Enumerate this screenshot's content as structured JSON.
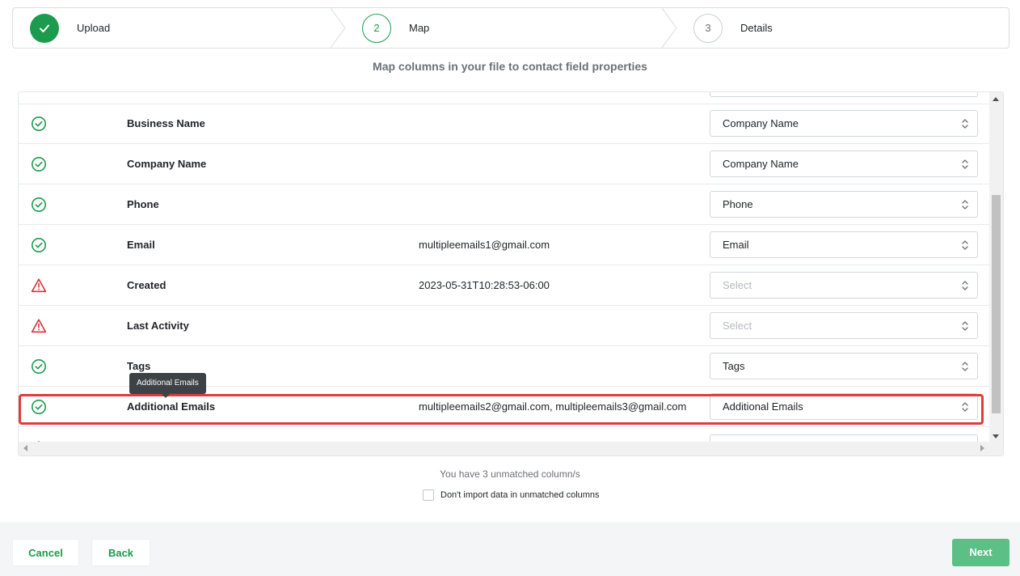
{
  "stepper": {
    "steps": [
      {
        "number": "",
        "label": "Upload",
        "state": "done"
      },
      {
        "number": "2",
        "label": "Map",
        "state": "active"
      },
      {
        "number": "3",
        "label": "Details",
        "state": "pending"
      }
    ]
  },
  "subtitle": "Map columns in your file to contact field properties",
  "rows": [
    {
      "status": "ok",
      "name": "Business Name",
      "sample": "",
      "field": "Company Name"
    },
    {
      "status": "ok",
      "name": "Company Name",
      "sample": "",
      "field": "Company Name"
    },
    {
      "status": "ok",
      "name": "Phone",
      "sample": "",
      "field": "Phone"
    },
    {
      "status": "ok",
      "name": "Email",
      "sample": "multipleemails1@gmail.com",
      "field": "Email"
    },
    {
      "status": "warn",
      "name": "Created",
      "sample": "2023-05-31T10:28:53-06:00",
      "field": "Select"
    },
    {
      "status": "warn",
      "name": "Last Activity",
      "sample": "",
      "field": "Select"
    },
    {
      "status": "ok",
      "name": "Tags",
      "sample": "",
      "field": "Tags"
    },
    {
      "status": "ok",
      "name": "Additional Emails",
      "sample": "multipleemails2@gmail.com, multipleemails3@gmail.com",
      "field": "Additional Emails"
    }
  ],
  "tooltip": "Additional Emails",
  "unmatched_text": "You have 3 unmatched column/s",
  "dont_import_label": "Don't import data in unmatched columns",
  "footer": {
    "cancel": "Cancel",
    "back": "Back",
    "next": "Next"
  },
  "colors": {
    "brand_green": "#1c9b4e",
    "warn_red": "#d93636",
    "highlight_red": "#dc3d3d",
    "next_button": "#5cbf85"
  }
}
